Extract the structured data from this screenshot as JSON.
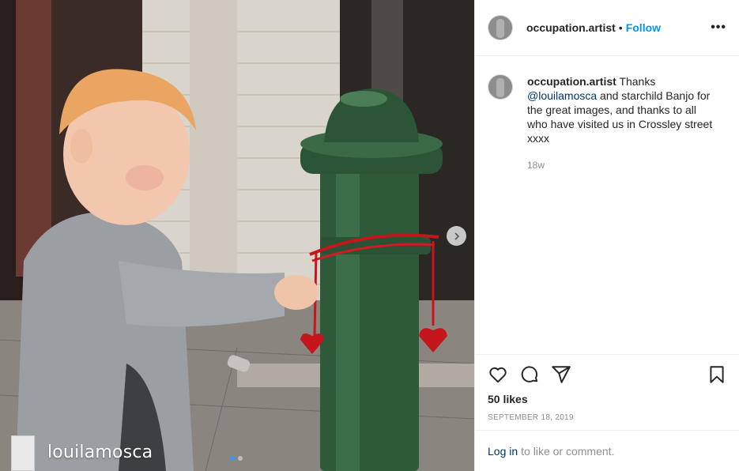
{
  "post": {
    "author": "occupation.artist",
    "separator": "•",
    "follow_label": "Follow",
    "more_label": "•••"
  },
  "caption": {
    "author": "occupation.artist",
    "text_before": "Thanks",
    "mention": "@louilamosca",
    "text_after": "and starchild Banjo for the great images, and thanks to all who have visited us in Crossley street xxxx",
    "age": "18w"
  },
  "engagement": {
    "likes": "50 likes",
    "date": "SEPTEMBER 18, 2019"
  },
  "footer": {
    "login_link": "Log in",
    "login_text": "to like or comment."
  },
  "photo": {
    "watermark_username": "louilamosca",
    "carousel_count": 2,
    "carousel_active": 1
  },
  "icons": {
    "like": "heart-icon",
    "comment": "comment-icon",
    "share": "share-icon",
    "save": "bookmark-icon",
    "next": "chevron-right-icon"
  },
  "colors": {
    "accent": "#0095f6",
    "mention": "#00376b",
    "muted": "#8e8e8e"
  }
}
